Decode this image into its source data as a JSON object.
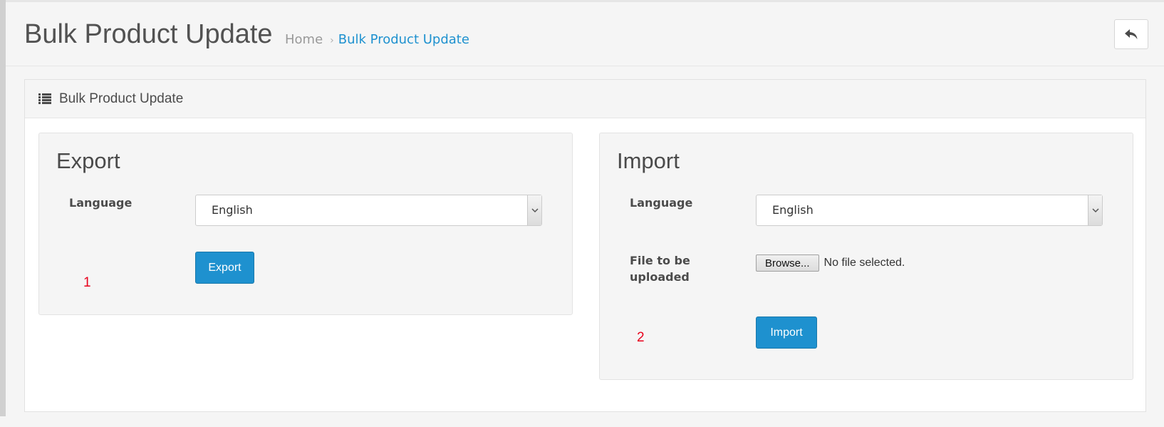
{
  "header": {
    "title": "Bulk Product Update",
    "breadcrumb": {
      "home": "Home",
      "separator": "›",
      "current": "Bulk Product Update"
    },
    "back_button_icon": "reply-icon"
  },
  "panel": {
    "heading": "Bulk Product Update",
    "heading_icon": "list-icon"
  },
  "export": {
    "title": "Export",
    "language_label": "Language",
    "language_value": "English",
    "button_label": "Export",
    "annotation": "1"
  },
  "import": {
    "title": "Import",
    "language_label": "Language",
    "language_value": "English",
    "file_label_line1": "File to be",
    "file_label_line2": "uploaded",
    "browse_label": "Browse...",
    "file_status": "No file selected.",
    "button_label": "Import",
    "annotation": "2"
  },
  "colors": {
    "primary": "#1e91cf",
    "annotation": "#e8001c",
    "background": "#f5f5f5"
  }
}
